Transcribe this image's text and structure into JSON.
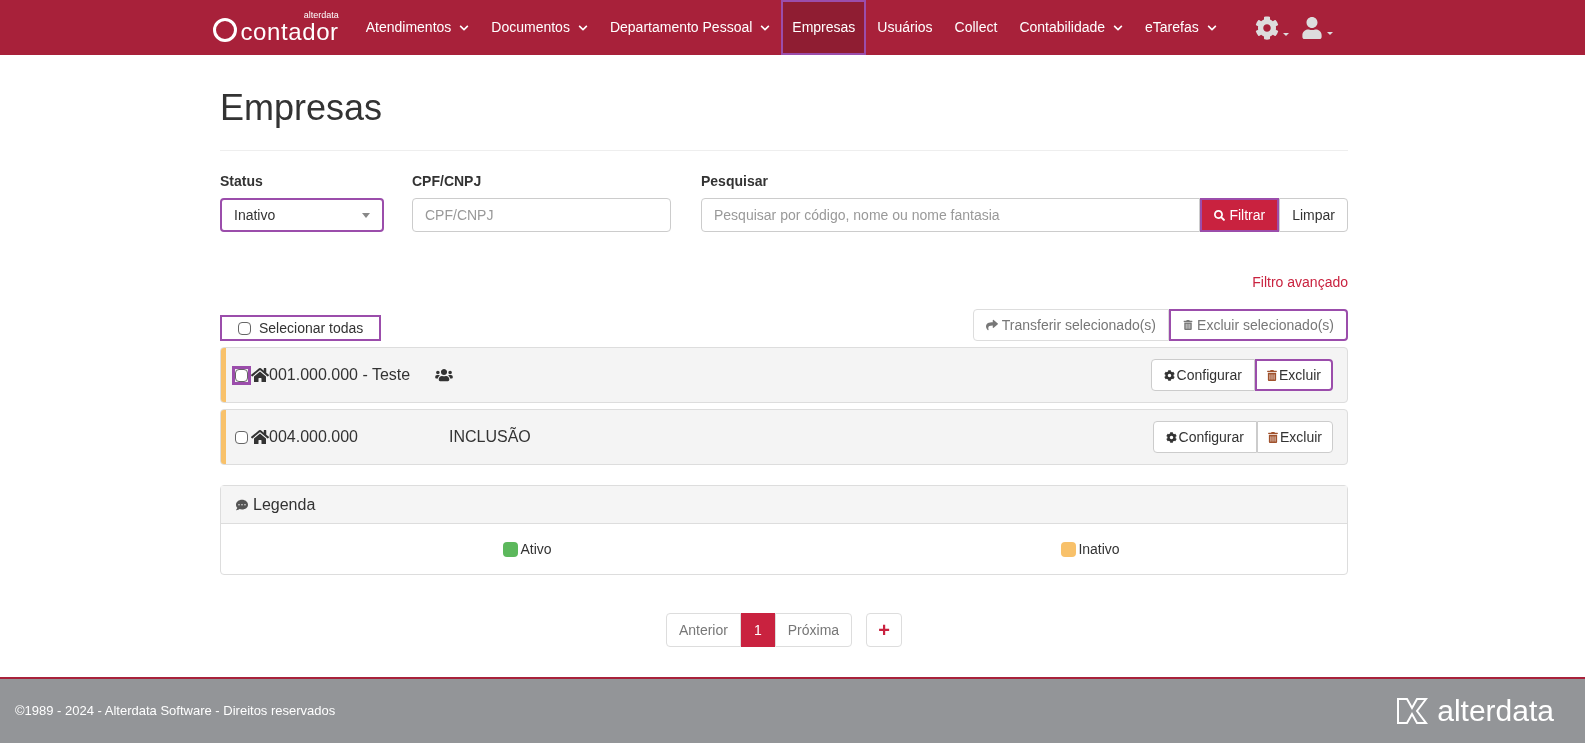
{
  "brand": {
    "small": "alterdata",
    "name": "contador"
  },
  "nav": [
    {
      "label": "Atendimentos",
      "dropdown": true,
      "selected": false,
      "highlighted": false
    },
    {
      "label": "Documentos",
      "dropdown": true,
      "selected": false,
      "highlighted": false
    },
    {
      "label": "Departamento Pessoal",
      "dropdown": true,
      "selected": false,
      "highlighted": false
    },
    {
      "label": "Empresas",
      "dropdown": false,
      "selected": true,
      "highlighted": true
    },
    {
      "label": "Usuários",
      "dropdown": false,
      "selected": false,
      "highlighted": false
    },
    {
      "label": "Collect",
      "dropdown": false,
      "selected": false,
      "highlighted": false
    },
    {
      "label": "Contabilidade",
      "dropdown": true,
      "selected": false,
      "highlighted": false
    },
    {
      "label": "eTarefas",
      "dropdown": true,
      "selected": false,
      "highlighted": false
    }
  ],
  "title": "Empresas",
  "filters": {
    "status": {
      "label": "Status",
      "value": "Inativo",
      "highlighted": true
    },
    "cpf": {
      "label": "CPF/CNPJ",
      "placeholder": "CPF/CNPJ"
    },
    "search": {
      "label": "Pesquisar",
      "placeholder": "Pesquisar por código, nome ou nome fantasia"
    },
    "filter_button": {
      "label": "Filtrar",
      "highlighted": true
    },
    "clear_button": {
      "label": "Limpar"
    },
    "advanced_link": "Filtro avançado"
  },
  "select_all": {
    "label": "Selecionar todas",
    "checked": false,
    "highlighted": true
  },
  "bulk_actions": [
    {
      "label": "Transferir selecionado(s)",
      "highlighted": false
    },
    {
      "label": "Excluir selecionado(s)",
      "highlighted": true
    }
  ],
  "rows": [
    {
      "name": "001.000.000 - Teste",
      "extra": "",
      "group_icon": true,
      "checked": false,
      "checkbox_highlighted": true,
      "color": "#f8c16a",
      "configure": "Configurar",
      "delete": "Excluir",
      "delete_highlighted": true
    },
    {
      "name": "004.000.000",
      "extra": "INCLUSÃO",
      "group_icon": false,
      "checked": false,
      "checkbox_highlighted": false,
      "color": "#f8c16a",
      "configure": "Configurar",
      "delete": "Excluir",
      "delete_highlighted": false
    }
  ],
  "legend": {
    "title": "Legenda",
    "items": [
      {
        "label": "Ativo",
        "color": "#5cb85c"
      },
      {
        "label": "Inativo",
        "color": "#f8c16a"
      }
    ]
  },
  "pagination": {
    "prev": "Anterior",
    "pages": [
      {
        "label": "1",
        "selected": true
      }
    ],
    "next": "Próxima",
    "add": "+"
  },
  "footer": {
    "text": "©1989 - 2024 - Alterdata Software - Direitos reservados",
    "logo": "alterdata"
  }
}
